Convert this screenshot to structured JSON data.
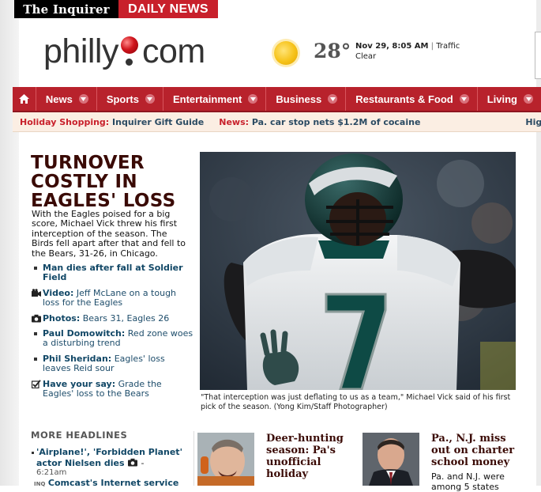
{
  "brand": {
    "inquirer": "The Inquirer",
    "daily_news": "DAILY NEWS",
    "logo_left": "philly",
    "logo_right": "com"
  },
  "weather": {
    "temp": "28°",
    "date": "Nov 29, 8:05 AM",
    "separator": "|",
    "traffic_link": "Traffic",
    "condition": "Clear"
  },
  "nav": {
    "items": [
      "News",
      "Sports",
      "Entertainment",
      "Business",
      "Restaurants & Food",
      "Living"
    ]
  },
  "ticker": {
    "items": [
      {
        "label": "Holiday Shopping:",
        "text": "Inquirer Gift Guide"
      },
      {
        "label": "News:",
        "text": "Pa. car stop nets $1.2M of cocaine"
      },
      {
        "label": "",
        "text": "High Sch"
      }
    ]
  },
  "lead": {
    "headline": "TURNOVER COSTLY IN EAGLES' LOSS",
    "dek": "With the Eagles poised for a big score, Michael Vick threw his first interception of the season. The Birds fell apart after that and fell to the Bears, 31-26, in Chicago.",
    "related": [
      {
        "icon": "bullet",
        "bold": "Man dies after fall at Soldier Field",
        "text": ""
      },
      {
        "icon": "video-icon",
        "bold": "Video:",
        "text": " Jeff McLane on a tough loss for the Eagles"
      },
      {
        "icon": "camera-icon",
        "bold": "Photos:",
        "text": " Bears 31, Eagles 26"
      },
      {
        "icon": "bullet",
        "bold": "Paul Domowitch:",
        "text": " Red zone woes a disturbing trend"
      },
      {
        "icon": "bullet",
        "bold": "Phil Sheridan:",
        "text": " Eagles' loss leaves Reid sour"
      },
      {
        "icon": "checkbox-icon",
        "bold": "Have your say:",
        "text": " Grade the Eagles' loss to the Bears"
      }
    ],
    "caption": "\"That interception was just deflating to us as a team,\" Michael Vick said of his first pick of the season. (Yong Kim/Staff Photographer)"
  },
  "more": {
    "title": "MORE HEADLINES",
    "items": [
      {
        "bold": "'Airplane!', 'Forbidden Planet' actor Nielsen dies",
        "time": "6:21am"
      },
      {
        "badge": "INQ",
        "bold": "Comcast's Internet service",
        "time": ""
      }
    ]
  },
  "stories": [
    {
      "title": "Deer-hunting season: Pa's unofficial holiday",
      "dek": ""
    },
    {
      "title": "Pa., N.J. miss out on charter school money",
      "dek": "Pa. and N.J. were among 5 states"
    }
  ],
  "colors": {
    "nav_red": "#b8222c",
    "headline_brown": "#3a0a05",
    "link_blue": "#114766",
    "ticker_bg": "#fbeee3"
  }
}
